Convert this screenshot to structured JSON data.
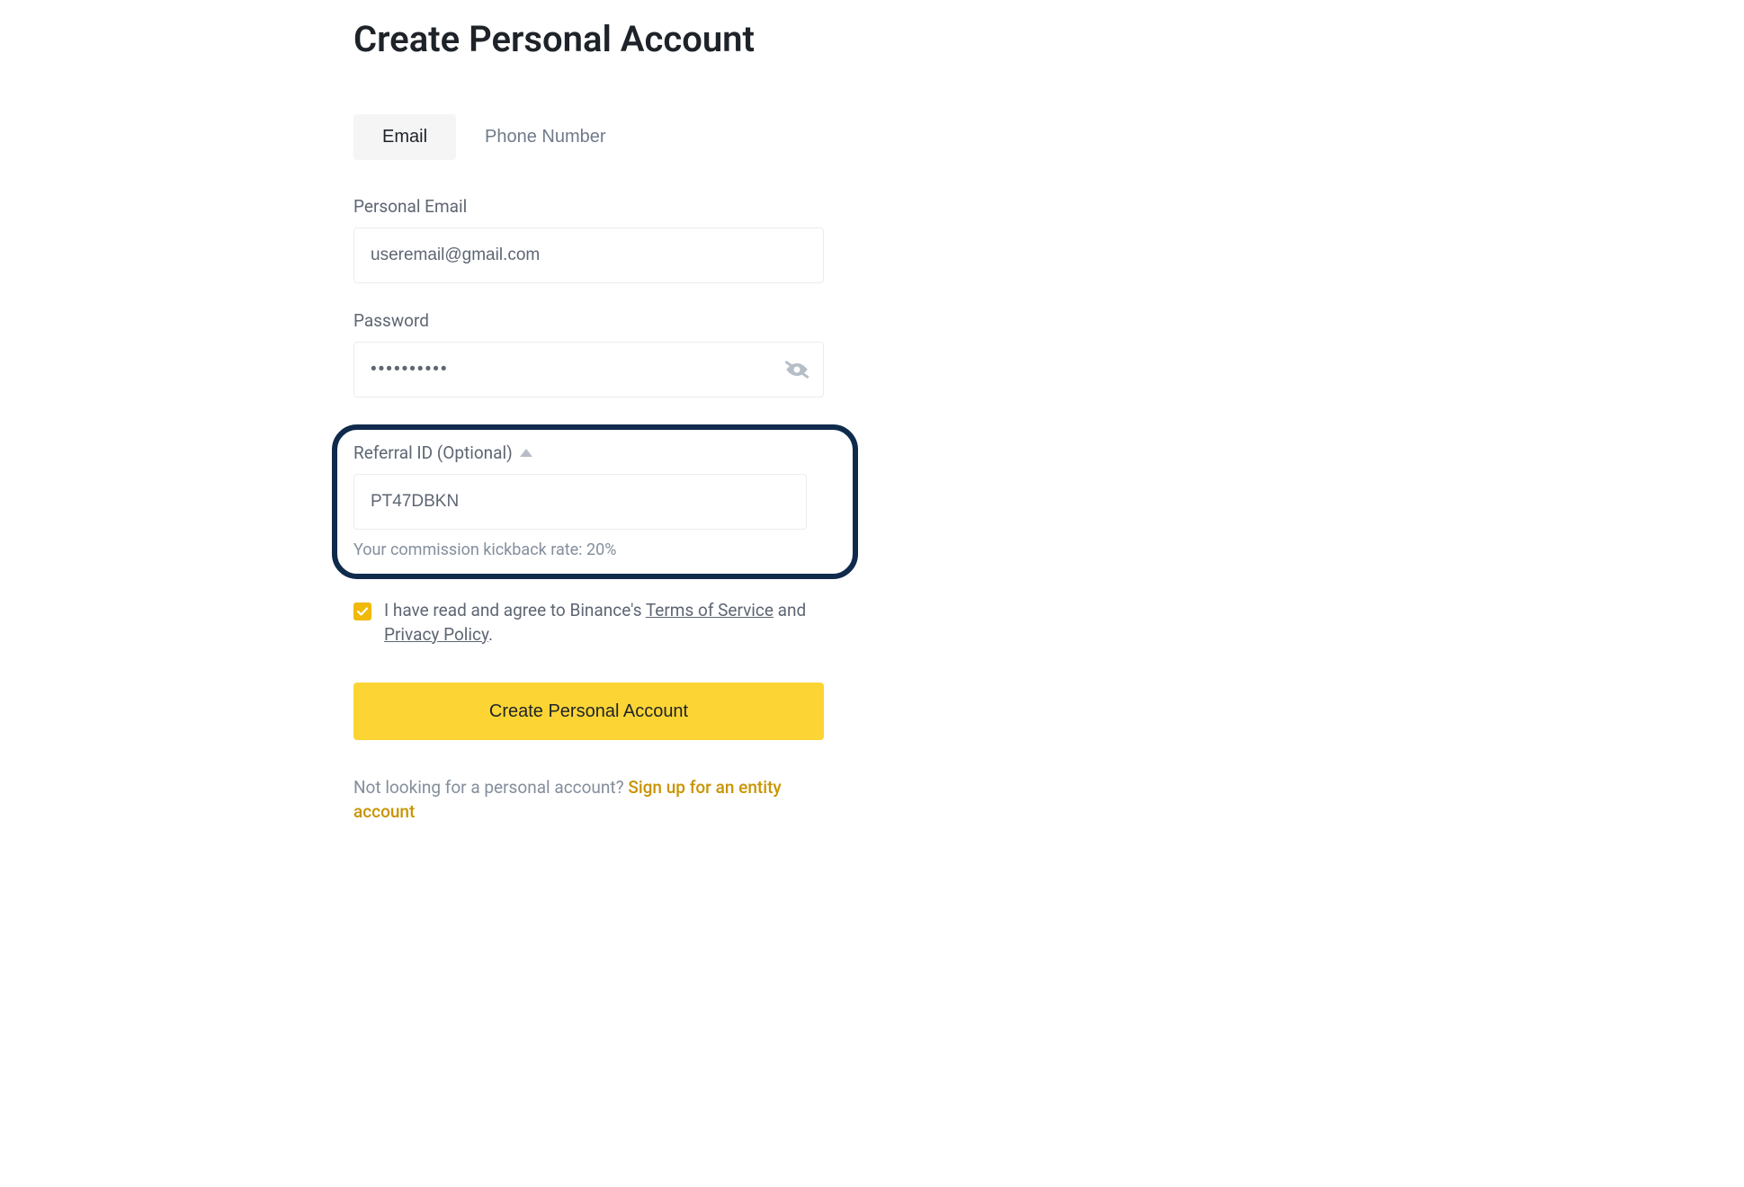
{
  "title": "Create Personal Account",
  "tabs": {
    "email": "Email",
    "phone": "Phone Number"
  },
  "fields": {
    "email": {
      "label": "Personal Email",
      "value": "useremail@gmail.com"
    },
    "password": {
      "label": "Password",
      "value": "••••••••••"
    },
    "referral": {
      "label": "Referral ID (Optional)",
      "value": "PT47DBKN",
      "helper": "Your commission kickback rate: 20%"
    }
  },
  "consent": {
    "prefix": "I have read and agree to Binance's ",
    "tos": "Terms of Service",
    "middle": " and ",
    "privacy": "Privacy Policy",
    "suffix": "."
  },
  "button": "Create Personal Account",
  "footer": {
    "prefix": "Not looking for a personal account? ",
    "link": "Sign up for an entity account"
  }
}
